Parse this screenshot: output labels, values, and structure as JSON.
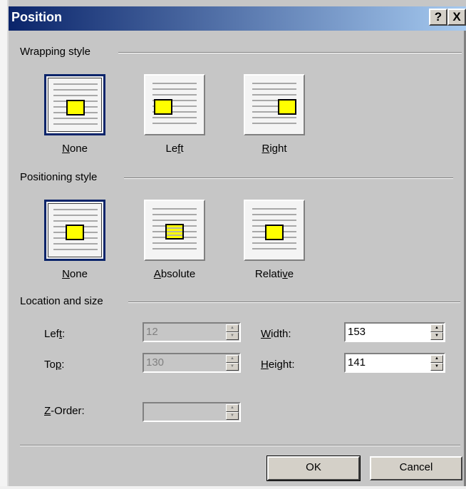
{
  "window": {
    "title": "Position",
    "help_glyph": "?",
    "close_glyph": "X"
  },
  "sections": {
    "wrapping": "Wrapping style",
    "positioning": "Positioning style",
    "location": "Location and size"
  },
  "wrapping_options": [
    {
      "label": "None",
      "selected": true
    },
    {
      "label": "Left",
      "selected": false
    },
    {
      "label": "Right",
      "selected": false
    }
  ],
  "positioning_options": [
    {
      "label": "None",
      "selected": true
    },
    {
      "label": "Absolute",
      "selected": false
    },
    {
      "label": "Relative",
      "selected": false
    }
  ],
  "fields": {
    "left": {
      "label": "Left:",
      "value": "12",
      "enabled": false
    },
    "top": {
      "label": "Top:",
      "value": "130",
      "enabled": false
    },
    "width": {
      "label": "Width:",
      "value": "153",
      "enabled": true
    },
    "height": {
      "label": "Height:",
      "value": "141",
      "enabled": true
    },
    "zorder": {
      "label": "Z-Order:",
      "value": "",
      "enabled": false
    }
  },
  "buttons": {
    "ok": "OK",
    "cancel": "Cancel"
  },
  "colors": {
    "title_start": "#0a246a",
    "title_end": "#a6caf0",
    "face": "#c6c6c6",
    "image_box": "#ffff00"
  }
}
